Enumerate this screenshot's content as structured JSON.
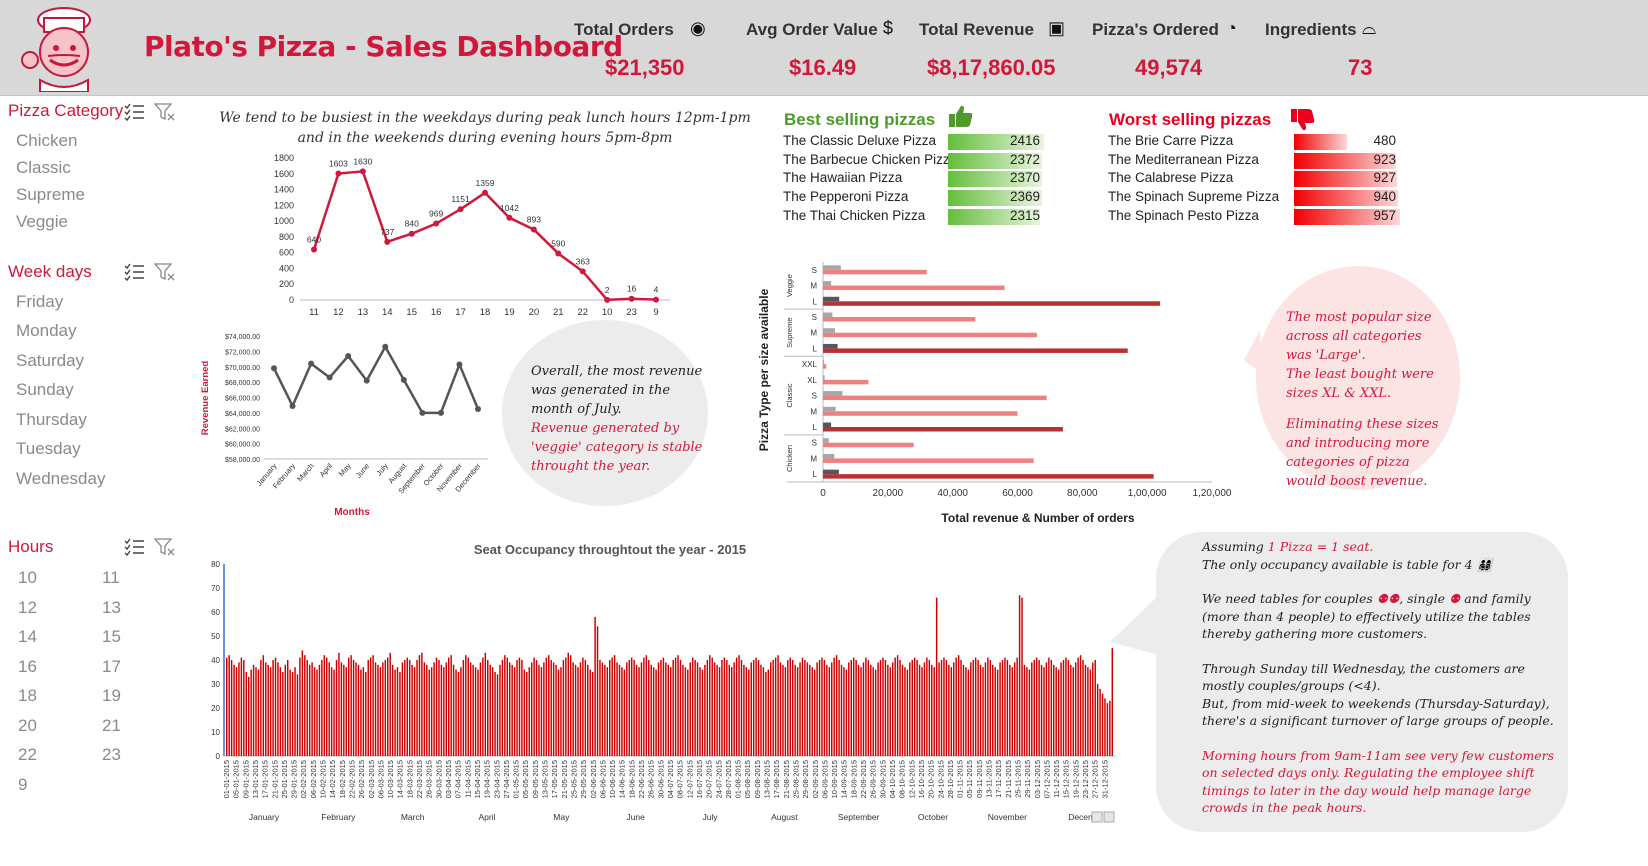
{
  "header": {
    "title": "Plato's Pizza - Sales Dashboard",
    "kpis": [
      {
        "label": "Total Orders",
        "value": "$21,350",
        "icon": "plate-icon"
      },
      {
        "label": "Avg Order Value",
        "value": "$16.49",
        "icon": "dollar-icon"
      },
      {
        "label": "Total Revenue",
        "value": "$8,17,860.05",
        "icon": "cash-icon"
      },
      {
        "label": "Pizza's Ordered",
        "value": "49,574",
        "icon": "pizza-slice-icon"
      },
      {
        "label": "Ingredients",
        "value": "73",
        "icon": "food-cover-icon"
      }
    ],
    "icon_glyphs": {
      "plate": "◉",
      "dollar": "$",
      "cash": "▣",
      "pizza": "◔",
      "cover": "⌓"
    }
  },
  "slicers": {
    "category": {
      "title": "Pizza Category",
      "items": [
        "Chicken",
        "Classic",
        "Supreme",
        "Veggie"
      ]
    },
    "weekdays": {
      "title": "Week days",
      "items": [
        "Friday",
        "Monday",
        "Saturday",
        "Sunday",
        "Thursday",
        "Tuesday",
        "Wednesday"
      ]
    },
    "hours": {
      "title": "Hours",
      "items": [
        "10",
        "11",
        "12",
        "13",
        "14",
        "15",
        "16",
        "17",
        "18",
        "19",
        "20",
        "21",
        "22",
        "23",
        "9"
      ]
    }
  },
  "notes": {
    "busiest": "We tend to be busiest in the weekdays during peak lunch hours 12pm-1pm and in the weekends during evening hours 5pm-8pm",
    "revenue_p1": "Overall, the most revenue was generated in the month of July.",
    "revenue_p2": "Revenue generated by 'veggie' category is stable throught the year.",
    "size_p1": "The most popular size across all categories was 'Large'.",
    "size_p2": "The least bought were sizes XL & XXL.",
    "size_p3": "Eliminating these sizes and introducing more categories of pizza would boost revenue.",
    "seat_l1a": "Assuming",
    "seat_l1b": "1 Pizza = 1 seat.",
    "seat_l2": "The only occupancy available is table for 4",
    "seat_l3a": "We need tables for couples",
    "seat_l3b": ", single",
    "seat_l3c": "and family (more than 4 people) to effectively utilize the tables thereby gathering more customers.",
    "seat_l4": "Through Sunday till Wednesday, the customers are mostly couples/groups (<4).",
    "seat_l5": "But, from mid-week to weekends (Thursday-Saturday), there's a significant turnover of large groups of people.",
    "seat_l6": "Morning hours from 9am-11am see very few customers on selected days only. Regulating the employee shift timings to later in the day would help manage large crowds in the peak hours."
  },
  "best_selling": {
    "title": "Best selling pizzas",
    "icon": "thumbs-up-icon",
    "color": "#4e9a2b",
    "items": [
      {
        "name": "The Classic Deluxe Pizza",
        "value": 2416
      },
      {
        "name": "The Barbecue Chicken Pizza",
        "value": 2372
      },
      {
        "name": "The Hawaiian Pizza",
        "value": 2370
      },
      {
        "name": "The Pepperoni Pizza",
        "value": 2369
      },
      {
        "name": "The Thai Chicken Pizza",
        "value": 2315
      }
    ]
  },
  "worst_selling": {
    "title": "Worst selling pizzas",
    "icon": "thumbs-down-icon",
    "color": "#e8001c",
    "items": [
      {
        "name": "The Brie Carre Pizza",
        "value": 480
      },
      {
        "name": "The Mediterranean Pizza",
        "value": 923
      },
      {
        "name": "The Calabrese Pizza",
        "value": 927
      },
      {
        "name": "The Spinach Supreme Pizza",
        "value": 940
      },
      {
        "name": "The Spinach Pesto Pizza",
        "value": 957
      }
    ]
  },
  "chart_data": [
    {
      "type": "line",
      "name": "orders-by-hour",
      "categories": [
        "11",
        "12",
        "13",
        "14",
        "15",
        "16",
        "17",
        "18",
        "19",
        "20",
        "21",
        "22",
        "10",
        "23",
        "9"
      ],
      "values": [
        640,
        1603,
        1630,
        737,
        840,
        969,
        1151,
        1359,
        1042,
        893,
        590,
        363,
        2,
        16,
        4
      ],
      "ylim": [
        0,
        1800
      ],
      "yticks": [
        "0",
        "200",
        "400",
        "600",
        "800",
        "1000",
        "1200",
        "1400",
        "1600",
        "1800"
      ],
      "color": "#d1183a"
    },
    {
      "type": "line",
      "name": "revenue-by-month",
      "categories": [
        "January",
        "February",
        "March",
        "April",
        "May",
        "June",
        "July",
        "August",
        "September",
        "October",
        "November",
        "December"
      ],
      "values": [
        69800,
        64900,
        70400,
        68600,
        71400,
        68200,
        72600,
        68300,
        64000,
        64000,
        70300,
        64500
      ],
      "ylim": [
        58000,
        74000
      ],
      "yticks": [
        "$58,000.00",
        "$60,000.00",
        "$62,000.00",
        "$64,000.00",
        "$66,000.00",
        "$68,000.00",
        "$70,000.00",
        "$72,000.00",
        "$74,000.00"
      ],
      "xlabel": "Months",
      "ylabel": "Revenue Earned",
      "color": "#555555"
    },
    {
      "type": "bar",
      "name": "revenue-by-size",
      "orientation": "horizontal",
      "groups": [
        {
          "name": "Veggie",
          "rows": [
            {
              "size": "S",
              "orders": 5500,
              "revenue": 32000
            },
            {
              "size": "M",
              "orders": 2500,
              "revenue": 56000
            },
            {
              "size": "L",
              "orders": 5000,
              "revenue": 104000
            }
          ]
        },
        {
          "name": "Supreme",
          "rows": [
            {
              "size": "S",
              "orders": 2900,
              "revenue": 47000
            },
            {
              "size": "M",
              "orders": 3700,
              "revenue": 66000
            },
            {
              "size": "L",
              "orders": 4500,
              "revenue": 94000
            }
          ]
        },
        {
          "name": "Classic",
          "rows": [
            {
              "size": "XXL",
              "orders": 30,
              "revenue": 1000
            },
            {
              "size": "XL",
              "orders": 500,
              "revenue": 14000
            },
            {
              "size": "S",
              "orders": 6000,
              "revenue": 69000
            },
            {
              "size": "M",
              "orders": 3900,
              "revenue": 60000
            },
            {
              "size": "L",
              "orders": 2500,
              "revenue": 74000
            }
          ]
        },
        {
          "name": "Chicken",
          "rows": [
            {
              "size": "S",
              "orders": 1800,
              "revenue": 28000
            },
            {
              "size": "M",
              "orders": 3500,
              "revenue": 65000
            },
            {
              "size": "L",
              "orders": 4900,
              "revenue": 102000
            }
          ]
        }
      ],
      "xlim": [
        0,
        120000
      ],
      "xticks": [
        "0",
        "20,000",
        "40,000",
        "60,000",
        "80,000",
        "1,00,000",
        "1,20,000"
      ],
      "xlabel": "Total revenue & Number of orders",
      "ylabel": "Pizza Type per size available",
      "colors": {
        "orders": "#a7a7a7",
        "orders_large": "#555566",
        "revenue": "#f08080",
        "revenue_large": "#b83232"
      }
    },
    {
      "type": "bar",
      "name": "seat-occupancy",
      "title": "Seat Occupancy throughtout the year - 2015",
      "ylim": [
        0,
        80
      ],
      "yticks": [
        "0",
        "10",
        "20",
        "30",
        "40",
        "50",
        "60",
        "70",
        "80"
      ],
      "date_labels": [
        "01-01-2015",
        "05-01-2015",
        "09-01-2015",
        "13-01-2015",
        "17-01-2015",
        "21-01-2015",
        "25-01-2015",
        "29-01-2015",
        "02-02-2015",
        "06-02-2015",
        "10-02-2015",
        "14-02-2015",
        "18-02-2015",
        "22-02-2015",
        "26-02-2015",
        "02-03-2015",
        "06-03-2015",
        "10-03-2015",
        "14-03-2015",
        "18-03-2015",
        "22-03-2015",
        "26-03-2015",
        "30-03-2015",
        "03-04-2015",
        "07-04-2015",
        "11-04-2015",
        "15-04-2015",
        "19-04-2015",
        "23-04-2015",
        "27-04-2015",
        "01-05-2015",
        "05-05-2015",
        "09-05-2015",
        "13-05-2015",
        "17-05-2015",
        "21-05-2015",
        "25-05-2015",
        "29-05-2015",
        "02-06-2015",
        "06-06-2015",
        "10-06-2015",
        "14-06-2015",
        "18-06-2015",
        "22-06-2015",
        "26-06-2015",
        "30-06-2015",
        "04-07-2015",
        "08-07-2015",
        "12-07-2015",
        "16-07-2015",
        "20-07-2015",
        "24-07-2015",
        "28-07-2015",
        "01-08-2015",
        "05-08-2015",
        "09-08-2015",
        "13-08-2015",
        "17-08-2015",
        "21-08-2015",
        "25-08-2015",
        "29-08-2015",
        "02-09-2015",
        "06-09-2015",
        "10-09-2015",
        "14-09-2015",
        "18-09-2015",
        "22-09-2015",
        "26-09-2015",
        "30-09-2015",
        "04-10-2015",
        "08-10-2015",
        "12-10-2015",
        "16-10-2015",
        "20-10-2015",
        "24-10-2015",
        "28-10-2015",
        "01-11-2015",
        "05-11-2015",
        "09-11-2015",
        "13-11-2015",
        "17-11-2015",
        "21-11-2015",
        "25-11-2015",
        "29-11-2015",
        "03-12-2015",
        "07-12-2015",
        "11-12-2015",
        "15-12-2015",
        "19-12-2015",
        "23-12-2015",
        "27-12-2015",
        "31-12-2015"
      ],
      "months": [
        "January",
        "February",
        "March",
        "April",
        "May",
        "June",
        "July",
        "August",
        "September",
        "October",
        "November",
        "Decem"
      ],
      "values": [
        41,
        42,
        40,
        38,
        37,
        39,
        41,
        40,
        35,
        33,
        36,
        38,
        37,
        36,
        40,
        42,
        39,
        38,
        37,
        40,
        41,
        39,
        37,
        35,
        38,
        40,
        36,
        35,
        37,
        34,
        41,
        44,
        42,
        40,
        38,
        39,
        37,
        36,
        38,
        40,
        42,
        41,
        39,
        37,
        36,
        40,
        43,
        39,
        38,
        37,
        41,
        42,
        40,
        39,
        38,
        36,
        37,
        35,
        40,
        41,
        42,
        39,
        38,
        37,
        39,
        40,
        41,
        43,
        38,
        36,
        37,
        35,
        39,
        40,
        41,
        40,
        38,
        37,
        40,
        42,
        43,
        39,
        38,
        36,
        37,
        39,
        41,
        40,
        38,
        37,
        39,
        41,
        42,
        38,
        36,
        35,
        37,
        40,
        42,
        41,
        39,
        38,
        37,
        36,
        39,
        41,
        43,
        40,
        38,
        37,
        35,
        34,
        38,
        40,
        42,
        41,
        39,
        38,
        37,
        40,
        41,
        40,
        36,
        35,
        37,
        39,
        41,
        40,
        38,
        37,
        39,
        41,
        42,
        40,
        39,
        38,
        36,
        37,
        40,
        41,
        43,
        42,
        39,
        38,
        37,
        39,
        41,
        40,
        38,
        36,
        35,
        58,
        54,
        40,
        39,
        38,
        37,
        40,
        41,
        42,
        39,
        38,
        37,
        36,
        39,
        40,
        41,
        40,
        38,
        37,
        39,
        41,
        42,
        40,
        38,
        37,
        36,
        39,
        40,
        41,
        39,
        38,
        37,
        40,
        41,
        42,
        40,
        38,
        37,
        36,
        39,
        41,
        40,
        39,
        37,
        36,
        38,
        40,
        42,
        41,
        39,
        38,
        37,
        40,
        41,
        40,
        38,
        37,
        39,
        41,
        42,
        40,
        38,
        37,
        36,
        39,
        40,
        41,
        40,
        38,
        37,
        35,
        36,
        39,
        40,
        41,
        42,
        39,
        38,
        37,
        40,
        41,
        40,
        38,
        37,
        39,
        41,
        40,
        39,
        38,
        37,
        36,
        39,
        40,
        41,
        40,
        38,
        37,
        39,
        41,
        42,
        40,
        38,
        37,
        36,
        39,
        40,
        41,
        40,
        38,
        37,
        39,
        41,
        40,
        38,
        37,
        36,
        39,
        40,
        41,
        40,
        38,
        37,
        39,
        41,
        42,
        40,
        38,
        37,
        36,
        39,
        40,
        41,
        40,
        38,
        37,
        39,
        41,
        40,
        38,
        37,
        66,
        39,
        40,
        41,
        40,
        38,
        37,
        39,
        41,
        42,
        40,
        38,
        37,
        36,
        39,
        40,
        41,
        40,
        38,
        37,
        39,
        41,
        40,
        38,
        37,
        36,
        39,
        40,
        41,
        40,
        38,
        37,
        39,
        41,
        67,
        66,
        38,
        37,
        36,
        39,
        40,
        41,
        40,
        38,
        37,
        39,
        41,
        40,
        38,
        37,
        36,
        39,
        40,
        41,
        40,
        38,
        37,
        39,
        41,
        42,
        40,
        38,
        37,
        36,
        39,
        40,
        30,
        28,
        26,
        24,
        22,
        23,
        45
      ]
    }
  ]
}
